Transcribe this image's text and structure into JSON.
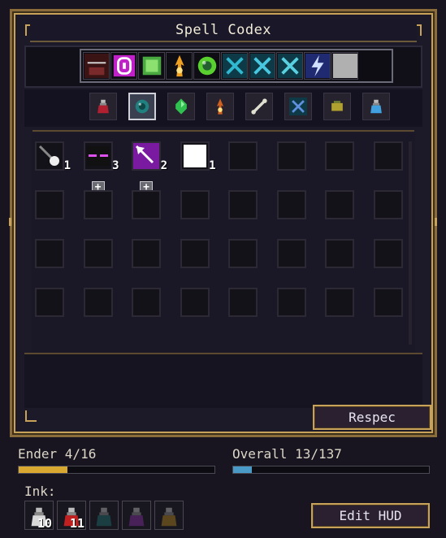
{
  "codex": {
    "title": "Spell Codex",
    "respec_label": "Respec"
  },
  "spell_bar": {
    "slots": [
      {
        "icon": "ruined-spider-icon",
        "color": "#7a2a2a"
      },
      {
        "icon": "ender-rune-icon",
        "color": "#c020c8"
      },
      {
        "icon": "green-cube-icon",
        "color": "#4aa840"
      },
      {
        "icon": "fire-burst-icon",
        "color": "#f0a020"
      },
      {
        "icon": "green-orb-icon",
        "color": "#5ad030"
      },
      {
        "icon": "ice-cross-icon",
        "color": "#30b8d0"
      },
      {
        "icon": "ice-shard-icon",
        "color": "#48c8e0"
      },
      {
        "icon": "frost-figure-icon",
        "color": "#58d0e0"
      },
      {
        "icon": "lightning-icon",
        "color": "#5070e0"
      },
      {
        "icon": "empty-slot-icon",
        "color": "#b0b0b0"
      }
    ]
  },
  "categories": [
    {
      "icon": "red-potion-icon",
      "color": "#b02030",
      "active": false
    },
    {
      "icon": "ender-pearl-icon",
      "color": "#208080",
      "active": true
    },
    {
      "icon": "emerald-icon",
      "color": "#30c050",
      "active": false
    },
    {
      "icon": "fire-charge-icon",
      "color": "#d06020",
      "active": false
    },
    {
      "icon": "bone-icon",
      "color": "#e0e0d0",
      "active": false
    },
    {
      "icon": "wind-charge-icon",
      "color": "#6090e0",
      "active": false
    },
    {
      "icon": "ochre-item-icon",
      "color": "#b0a030",
      "active": false
    },
    {
      "icon": "blue-potion-icon",
      "color": "#40a0e0",
      "active": false
    }
  ],
  "grid_spells": [
    {
      "icon": "white-comet-icon",
      "count": "1",
      "plus": false
    },
    {
      "icon": "enderman-face-icon",
      "count": "3",
      "plus": true
    },
    {
      "icon": "purple-arrow-icon",
      "count": "2",
      "plus": true
    },
    {
      "icon": "ender-rune-icon",
      "count": "1",
      "plus": false
    }
  ],
  "stats": {
    "ender_label": "Ender 4/16",
    "ender_progress": 0.25,
    "ender_color": "#d8a830",
    "overall_label": "Overall 13/137",
    "overall_progress": 0.095,
    "overall_color": "#4a9ac8"
  },
  "ink": {
    "label": "Ink:",
    "items": [
      {
        "icon": "white-ink-icon",
        "count": "10",
        "color": "#d8d8d8"
      },
      {
        "icon": "red-ink-icon",
        "count": "11",
        "color": "#c02020"
      },
      {
        "icon": "teal-ink-icon",
        "count": "",
        "color": "#207070"
      },
      {
        "icon": "purple-ink-icon",
        "count": "",
        "color": "#8030a0"
      },
      {
        "icon": "gold-ink-icon",
        "count": "",
        "color": "#b08020"
      }
    ]
  },
  "edit_hud_label": "Edit HUD"
}
